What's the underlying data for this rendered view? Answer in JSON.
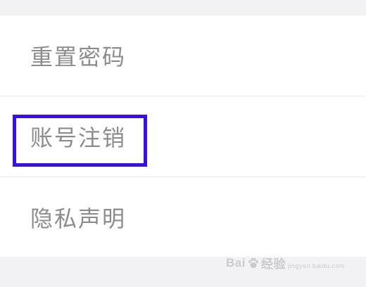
{
  "menu": {
    "items": [
      {
        "label": "重置密码"
      },
      {
        "label": "账号注销"
      },
      {
        "label": "隐私声明"
      }
    ]
  },
  "highlight": {
    "target_label": "账号注销",
    "color": "#3a10e0"
  },
  "watermark": {
    "text_left": "Bai",
    "icon": "paw-icon",
    "text_right": "经验",
    "subtext": "jingyan.baidu.com"
  },
  "colors": {
    "page_background": "#f2f2f4",
    "card_background": "#ffffff",
    "label_text": "#8c8c8c",
    "divider": "#ebebeb"
  }
}
